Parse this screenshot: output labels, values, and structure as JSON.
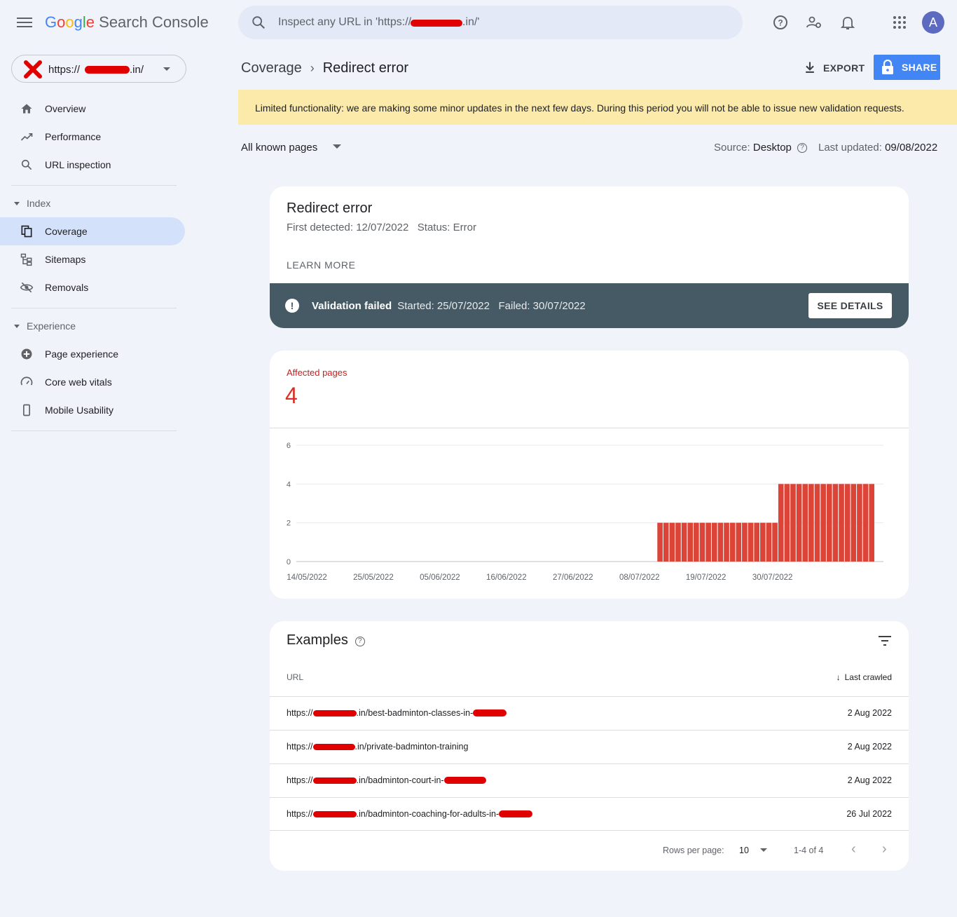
{
  "app": {
    "title_parts": [
      "G",
      "o",
      "o",
      "g",
      "l",
      "e"
    ],
    "title_rest": "Search Console"
  },
  "search": {
    "placeholder": "Inspect any URL in 'https://",
    "placeholder_suffix": ".in/'"
  },
  "avatar_letter": "A",
  "property": {
    "prefix": "https://",
    "suffix": ".in/"
  },
  "sidebar": {
    "items": [
      {
        "label": "Overview",
        "icon": "home-icon"
      },
      {
        "label": "Performance",
        "icon": "trending-up-icon"
      },
      {
        "label": "URL inspection",
        "icon": "search-icon"
      }
    ],
    "index_section": "Index",
    "index_items": [
      {
        "label": "Coverage",
        "icon": "coverage-icon",
        "active": true
      },
      {
        "label": "Sitemaps",
        "icon": "sitemap-icon"
      },
      {
        "label": "Removals",
        "icon": "eye-off-icon"
      }
    ],
    "experience_section": "Experience",
    "experience_items": [
      {
        "label": "Page experience",
        "icon": "plus-circle-icon"
      },
      {
        "label": "Core web vitals",
        "icon": "speed-icon"
      },
      {
        "label": "Mobile Usability",
        "icon": "phone-icon"
      }
    ]
  },
  "header": {
    "crumb1": "Coverage",
    "crumb2": "Redirect error",
    "export": "EXPORT",
    "share": "SHARE"
  },
  "notice": "Limited functionality: we are making some minor updates in the next few days. During this period you will not be able to issue new validation requests.",
  "filter": {
    "value": "All known pages",
    "source_label": "Source:",
    "source_value": "Desktop",
    "updated_label": "Last updated:",
    "updated_value": "09/08/2022"
  },
  "issue": {
    "title": "Redirect error",
    "meta": "First detected: 12/07/2022   Status: Error",
    "learn_more": "LEARN MORE",
    "validation_status": "Validation failed",
    "validation_details": "Started: 25/07/2022   Failed: 30/07/2022",
    "see_details": "SEE DETAILS"
  },
  "affected": {
    "label": "Affected pages",
    "value": "4"
  },
  "chart_data": {
    "type": "bar",
    "ylim": [
      0,
      6
    ],
    "yticks": [
      0,
      2,
      4,
      6
    ],
    "xtick_labels": [
      "14/05/2022",
      "25/05/2022",
      "05/06/2022",
      "16/06/2022",
      "27/06/2022",
      "08/07/2022",
      "19/07/2022",
      "30/07/2022"
    ],
    "start_date": "14/05/2022",
    "values": [
      0,
      0,
      0,
      0,
      0,
      0,
      0,
      0,
      0,
      0,
      0,
      0,
      0,
      0,
      0,
      0,
      0,
      0,
      0,
      0,
      0,
      0,
      0,
      0,
      0,
      0,
      0,
      0,
      0,
      0,
      0,
      0,
      0,
      0,
      0,
      0,
      0,
      0,
      0,
      0,
      0,
      0,
      0,
      0,
      0,
      0,
      0,
      0,
      0,
      0,
      0,
      0,
      0,
      0,
      0,
      0,
      0,
      0,
      0,
      2,
      2,
      2,
      2,
      2,
      2,
      2,
      2,
      2,
      2,
      2,
      2,
      2,
      2,
      2,
      2,
      2,
      2,
      2,
      2,
      4,
      4,
      4,
      4,
      4,
      4,
      4,
      4,
      4,
      4,
      4,
      4,
      4,
      4,
      4,
      4
    ],
    "color": "#db4437"
  },
  "examples": {
    "title": "Examples",
    "col_url": "URL",
    "col_crawled": "Last crawled",
    "rows": [
      {
        "prefix": "https://",
        "path": ".in/best-badminton-classes-in-",
        "date": "2 Aug 2022"
      },
      {
        "prefix": "https://",
        "path": ".in/private-badminton-training",
        "date": "2 Aug 2022"
      },
      {
        "prefix": "https://",
        "path": ".in/badminton-court-in-",
        "date": "2 Aug 2022"
      },
      {
        "prefix": "https://",
        "path": ".in/badminton-coaching-for-adults-in-",
        "date": "26 Jul 2022"
      }
    ],
    "rows_per_page_label": "Rows per page:",
    "rows_per_page": "10",
    "range": "1-4 of 4"
  }
}
